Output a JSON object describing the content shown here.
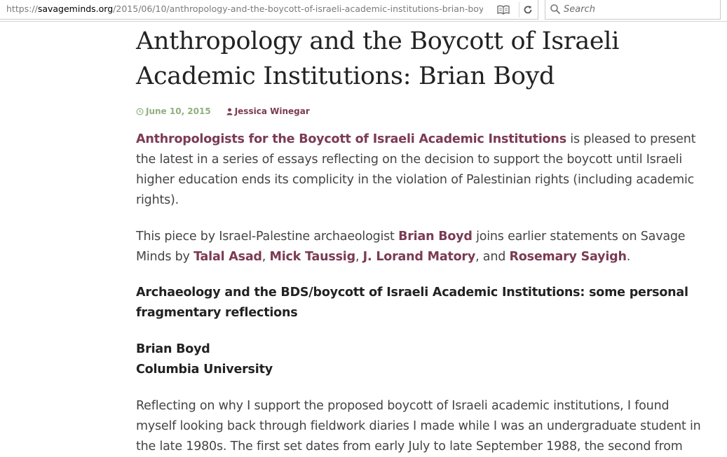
{
  "browser": {
    "url_prefix": "https://",
    "url_host": "savageminds.org",
    "url_path": "/2015/06/10/anthropology-and-the-boycott-of-israeli-academic-institutions-brian-boy",
    "search_placeholder": "Search",
    "icons": {
      "reader": "reader-view-icon",
      "reload": "reload-icon",
      "search": "search-icon"
    }
  },
  "post": {
    "title": "Anthropology and the Boycott of Israeli Academic Institutions: Brian Boyd",
    "date": "June 10, 2015",
    "author": "Jessica Winegar",
    "colors": {
      "link": "#7b3b54",
      "date": "#8fb07f"
    }
  },
  "body": {
    "p1": {
      "link": "Anthropologists for the Boycott of Israeli Academic Institutions",
      "text": " is pleased to present the latest in a series of essays reflecting on the decision to support the boycott until Israeli higher education ends its complicity in the violation of Palestinian rights (including academic rights)."
    },
    "p2": {
      "t1": "This piece by Israel-Palestine archaeologist ",
      "link1": "Brian Boyd",
      "t2": " joins earlier statements on Savage Minds by ",
      "link2": "Talal Asad",
      "t3": ", ",
      "link3": "Mick Taussig",
      "t4": ", ",
      "link4": "J. Lorand Matory",
      "t5": ", and ",
      "link5": "Rosemary Sayigh",
      "t6": "."
    },
    "essay_heading": "Archaeology and the BDS/boycott of Israeli Academic Institutions: some personal fragmentary reflections",
    "essay_author": "Brian Boyd",
    "essay_affiliation": "Columbia University",
    "p3": "Reflecting on why I support the proposed boycott of Israeli academic institutions, I found myself looking back through fieldwork diaries I made while I was an undergraduate student in the late 1980s. The first set dates from early July to late September 1988, the second from"
  }
}
